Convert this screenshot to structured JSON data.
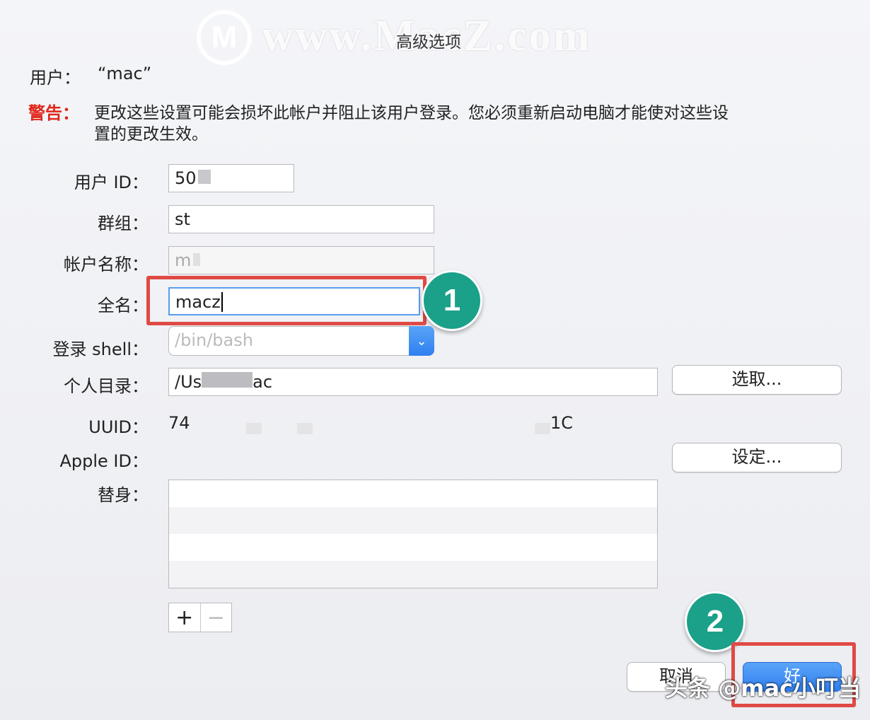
{
  "watermark": {
    "logo": "M",
    "text": "www.MacZ.com"
  },
  "dialog_title": "高级选项",
  "user": {
    "label": "用户：",
    "value": "“mac”"
  },
  "warning": {
    "label": "警告：",
    "text_line1": "更改这些设置可能会损坏此帐户并阻止该用户登录。您必须重新启动电脑才能使对这些设",
    "text_line2": "置的更改生效。"
  },
  "fields": {
    "user_id": {
      "label": "用户 ID：",
      "value": "50"
    },
    "group": {
      "label": "群组：",
      "value": "st"
    },
    "account_name": {
      "label": "帐户名称：",
      "value": "m"
    },
    "full_name": {
      "label": "全名：",
      "value": "macz"
    },
    "login_shell": {
      "label": "登录 shell：",
      "value": "/bin/bash"
    },
    "home_dir": {
      "label": "个人目录：",
      "value_prefix": "/Us",
      "value_suffix": "ac"
    },
    "uuid": {
      "label": "UUID：",
      "value_prefix": "74",
      "value_suffix": "1C"
    },
    "apple_id": {
      "label": "Apple ID："
    },
    "aliases": {
      "label": "替身："
    }
  },
  "buttons": {
    "choose": "选取...",
    "set": "设定...",
    "add": "+",
    "remove": "−",
    "cancel": "取消",
    "ok": "好"
  },
  "annotations": {
    "step1": "1",
    "step2": "2",
    "source": "头条 @mac小叮当"
  },
  "colors": {
    "accent": "#2f7ff0",
    "highlight": "#e04a44",
    "badge": "#1ba08a",
    "warning": "#e0261b"
  }
}
